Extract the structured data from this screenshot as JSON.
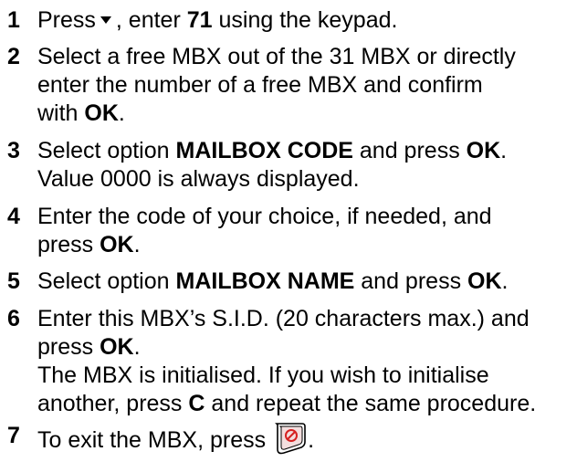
{
  "steps": [
    {
      "num": "1",
      "t1": "Press",
      "t2": ", enter",
      "b1": "71",
      "t3": " using the keypad."
    },
    {
      "num": "2",
      "l1": "Select a free MBX out of the 31 MBX or directly",
      "l2": "enter the number of a free MBX and confirm",
      "l3a": "with ",
      "l3b": "OK",
      "l3c": "."
    },
    {
      "num": "3",
      "l1a": "Select option ",
      "l1b": "MAILBOX CODE",
      "l1c": " and press ",
      "l1d": "OK",
      "l1e": ".",
      "l2": "Value 0000 is always displayed."
    },
    {
      "num": "4",
      "l1": "Enter the code of your choice, if needed, and",
      "l2a": "press ",
      "l2b": "OK",
      "l2c": "."
    },
    {
      "num": "5",
      "l1a": "Select option ",
      "l1b": "MAILBOX NAME",
      "l1c": " and press ",
      "l1d": "OK",
      "l1e": "."
    },
    {
      "num": "6",
      "l1": "Enter this MBX’s S.I.D. (20 characters max.) and",
      "l2a": "press ",
      "l2b": "OK",
      "l2c": ".",
      "l3": "The MBX is initialised. If you wish to initialise",
      "l4a": "another, press ",
      "l4b": "C",
      "l4c": " and repeat the same procedure."
    },
    {
      "num": "7",
      "t1": "To exit the MBX, press",
      "t2": "."
    }
  ],
  "icons": {
    "arrow": "down-arrow-key-icon",
    "stop": "stop-key-icon"
  }
}
